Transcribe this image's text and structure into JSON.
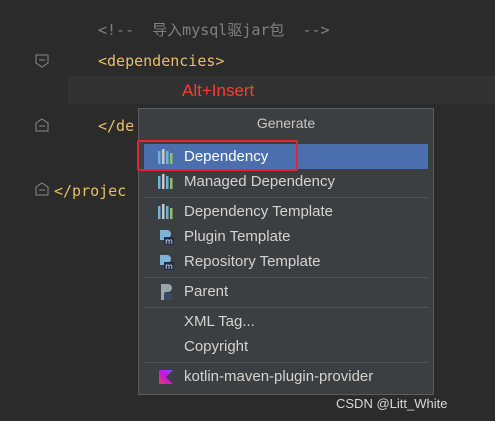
{
  "editor": {
    "comment_line": "<!--  导入mysql驱jar包  -->",
    "deps_open": "<dependencies>",
    "deps_close": "</de",
    "project_close": "</projec"
  },
  "annotation": {
    "shortcut": "Alt+Insert",
    "color": "#ff3b30"
  },
  "popup": {
    "title": "Generate",
    "items": [
      {
        "label": "Dependency",
        "icon": "maven-bars-icon",
        "selected": true
      },
      {
        "label": "Managed Dependency",
        "icon": "maven-bars-icon"
      },
      {
        "label": "Dependency Template",
        "icon": "maven-bars-icon"
      },
      {
        "label": "Plugin Template",
        "icon": "plugin-template-icon"
      },
      {
        "label": "Repository Template",
        "icon": "repository-template-icon"
      },
      {
        "label": "Parent",
        "icon": "parent-icon"
      },
      {
        "label": "XML Tag...",
        "icon": ""
      },
      {
        "label": "Copyright",
        "icon": ""
      },
      {
        "label": "kotlin-maven-plugin-provider",
        "icon": "kotlin-icon"
      }
    ]
  },
  "colors": {
    "selection": "#4b6eaf",
    "highlight_box": "#e5252a",
    "tag": "#e8bf6a"
  },
  "watermark": "CSDN @Litt_White"
}
